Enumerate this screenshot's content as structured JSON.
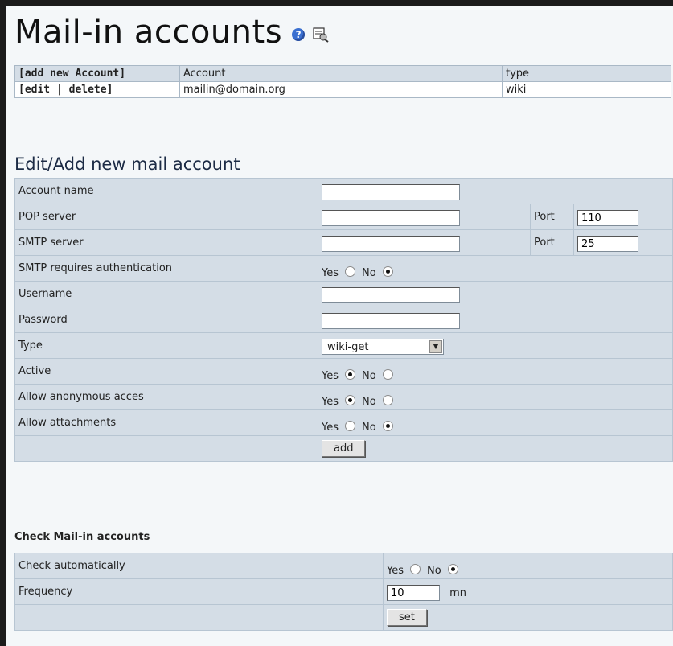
{
  "page": {
    "title": "Mail-in accounts",
    "help_icon": "help-icon",
    "config_icon": "config-icon"
  },
  "accounts_table": {
    "header": {
      "add_link": "[add new Account]",
      "col_account": "Account",
      "col_type": "type"
    },
    "rows": [
      {
        "actions": "[edit | delete]",
        "account": "mailin@domain.org",
        "type": "wiki"
      }
    ]
  },
  "form": {
    "title": "Edit/Add new mail account",
    "account_name_label": "Account name",
    "account_name_value": "",
    "pop_server_label": "POP server",
    "pop_server_value": "",
    "pop_port_label": "Port",
    "pop_port_value": "110",
    "smtp_server_label": "SMTP server",
    "smtp_server_value": "",
    "smtp_port_label": "Port",
    "smtp_port_value": "25",
    "smtp_auth_label": "SMTP requires authentication",
    "username_label": "Username",
    "username_value": "",
    "password_label": "Password",
    "password_value": "",
    "type_label": "Type",
    "type_value": "wiki-get",
    "active_label": "Active",
    "anon_label": "Allow anonymous acces",
    "attach_label": "Allow attachments",
    "yes": "Yes",
    "no": "No",
    "add_button": "add"
  },
  "check": {
    "title": "Check Mail-in accounts",
    "auto_label": "Check automatically",
    "freq_label": "Frequency",
    "freq_value": "10",
    "freq_unit": "mn",
    "yes": "Yes",
    "no": "No",
    "set_button": "set"
  }
}
